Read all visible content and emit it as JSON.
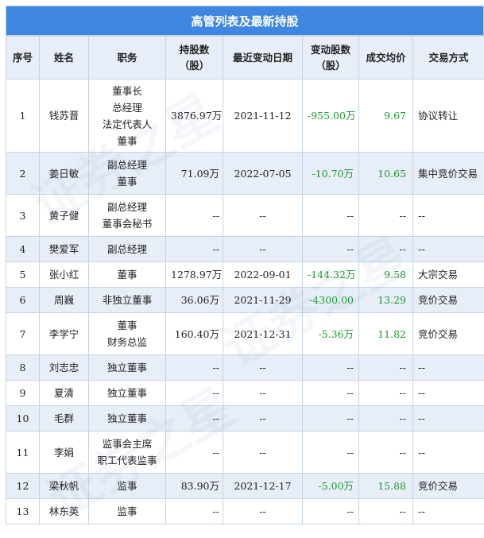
{
  "title": "高管列表及最新持股",
  "watermark_text": "证券之星",
  "headers": {
    "idx": "序号",
    "name": "姓名",
    "position": "职务",
    "holding": [
      "持股数",
      "（股）"
    ],
    "last_date": "最近变动日期",
    "change": [
      "变动股数",
      "（股）"
    ],
    "avg_price": "成交均价",
    "trade_type": "交易方式"
  },
  "rows": [
    {
      "idx": "1",
      "name": "钱苏晋",
      "position": [
        "董事长",
        "总经理",
        "法定代表人",
        "董事"
      ],
      "holding": "3876.97万",
      "date": "2021-11-12",
      "change": "-955.00万",
      "price": "9.67",
      "type": "协议转让"
    },
    {
      "idx": "2",
      "name": "姜日敏",
      "position": [
        "副总经理",
        "董事"
      ],
      "holding": "71.09万",
      "date": "2022-07-05",
      "change": "-10.70万",
      "price": "10.65",
      "type": "集中竞价交易"
    },
    {
      "idx": "3",
      "name": "黄子健",
      "position": [
        "副总经理",
        "董事会秘书"
      ],
      "holding": "--",
      "date": "--",
      "change": "--",
      "price": "--",
      "type": "--"
    },
    {
      "idx": "4",
      "name": "樊爱军",
      "position": [
        "副总经理"
      ],
      "holding": "--",
      "date": "--",
      "change": "--",
      "price": "--",
      "type": "--"
    },
    {
      "idx": "5",
      "name": "张小红",
      "position": [
        "董事"
      ],
      "holding": "1278.97万",
      "date": "2022-09-01",
      "change": "-144.32万",
      "price": "9.58",
      "type": "大宗交易"
    },
    {
      "idx": "6",
      "name": "周巍",
      "position": [
        "非独立董事"
      ],
      "holding": "36.06万",
      "date": "2021-11-29",
      "change": "-4300.00",
      "price": "13.29",
      "type": "竞价交易"
    },
    {
      "idx": "7",
      "name": "李学宁",
      "position": [
        "董事",
        "财务总监"
      ],
      "holding": "160.40万",
      "date": "2021-12-31",
      "change": "-5.36万",
      "price": "11.82",
      "type": "竞价交易"
    },
    {
      "idx": "8",
      "name": "刘志忠",
      "position": [
        "独立董事"
      ],
      "holding": "--",
      "date": "--",
      "change": "--",
      "price": "--",
      "type": "--"
    },
    {
      "idx": "9",
      "name": "夏清",
      "position": [
        "独立董事"
      ],
      "holding": "--",
      "date": "--",
      "change": "--",
      "price": "--",
      "type": "--"
    },
    {
      "idx": "10",
      "name": "毛群",
      "position": [
        "独立董事"
      ],
      "holding": "--",
      "date": "--",
      "change": "--",
      "price": "--",
      "type": "--"
    },
    {
      "idx": "11",
      "name": "李娟",
      "position": [
        "监事会主席",
        "职工代表监事"
      ],
      "holding": "--",
      "date": "--",
      "change": "--",
      "price": "--",
      "type": "--"
    },
    {
      "idx": "12",
      "name": "梁秋帆",
      "position": [
        "监事"
      ],
      "holding": "83.90万",
      "date": "2021-12-17",
      "change": "-5.00万",
      "price": "15.88",
      "type": "竞价交易"
    },
    {
      "idx": "13",
      "name": "林东英",
      "position": [
        "监事"
      ],
      "holding": "--",
      "date": "--",
      "change": "--",
      "price": "--",
      "type": "--"
    }
  ],
  "colors": {
    "header_bar": "#3f86e0",
    "header_row": "#e7eef8",
    "stripe": "#e8eef7",
    "negative_change": "#1a9a2e"
  }
}
